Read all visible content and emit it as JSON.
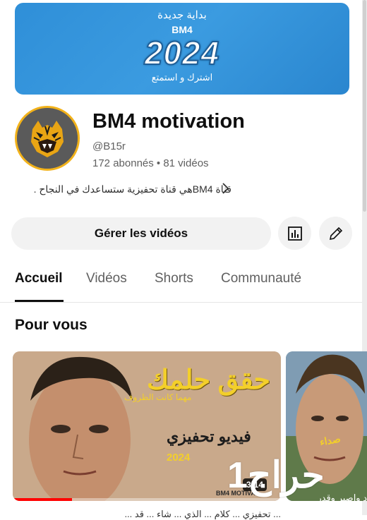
{
  "banner": {
    "top_text": "بداية جديدة",
    "brand": "BM4",
    "year": "2024",
    "subtitle": "اشترك و استمتع"
  },
  "channel": {
    "name": "BM4 motivation",
    "handle": "@B15r",
    "stats": "172 abonnés • 81 vidéos",
    "description": "قناة BM4هي قناة تحفيزية ستساعدك في النجاح ."
  },
  "actions": {
    "manage_label": "Gérer les vidéos",
    "analytics_icon": "analytics-icon",
    "edit_icon": "pencil-icon"
  },
  "tabs": [
    {
      "label": "Accueil",
      "active": true
    },
    {
      "label": "Vidéos",
      "active": false
    },
    {
      "label": "Shorts",
      "active": false
    },
    {
      "label": "Communauté",
      "active": false
    }
  ],
  "section": {
    "title": "Pour vous"
  },
  "videos": [
    {
      "thumb_title": "حقق حلمك",
      "thumb_subtitle": "مهما كانت الظروف",
      "thumb_heading": "فيديو تحفيزي",
      "thumb_year": "2024",
      "thumb_brand": "BM4 MOTIVA",
      "duration": "3:14",
      "progress": 0.22,
      "caption": "... تحفيزي ... كلام ... الذي ... شاء ... قد ..."
    },
    {
      "thumb_text": "صداء",
      "thumb_caption": "د واصبر وقدر"
    }
  ],
  "watermark": "حراج1",
  "colors": {
    "banner": "#3b9be0",
    "avatar_ring": "#f2b21a",
    "progress": "#ff0000",
    "thumb_accent": "#f3cf2a"
  }
}
